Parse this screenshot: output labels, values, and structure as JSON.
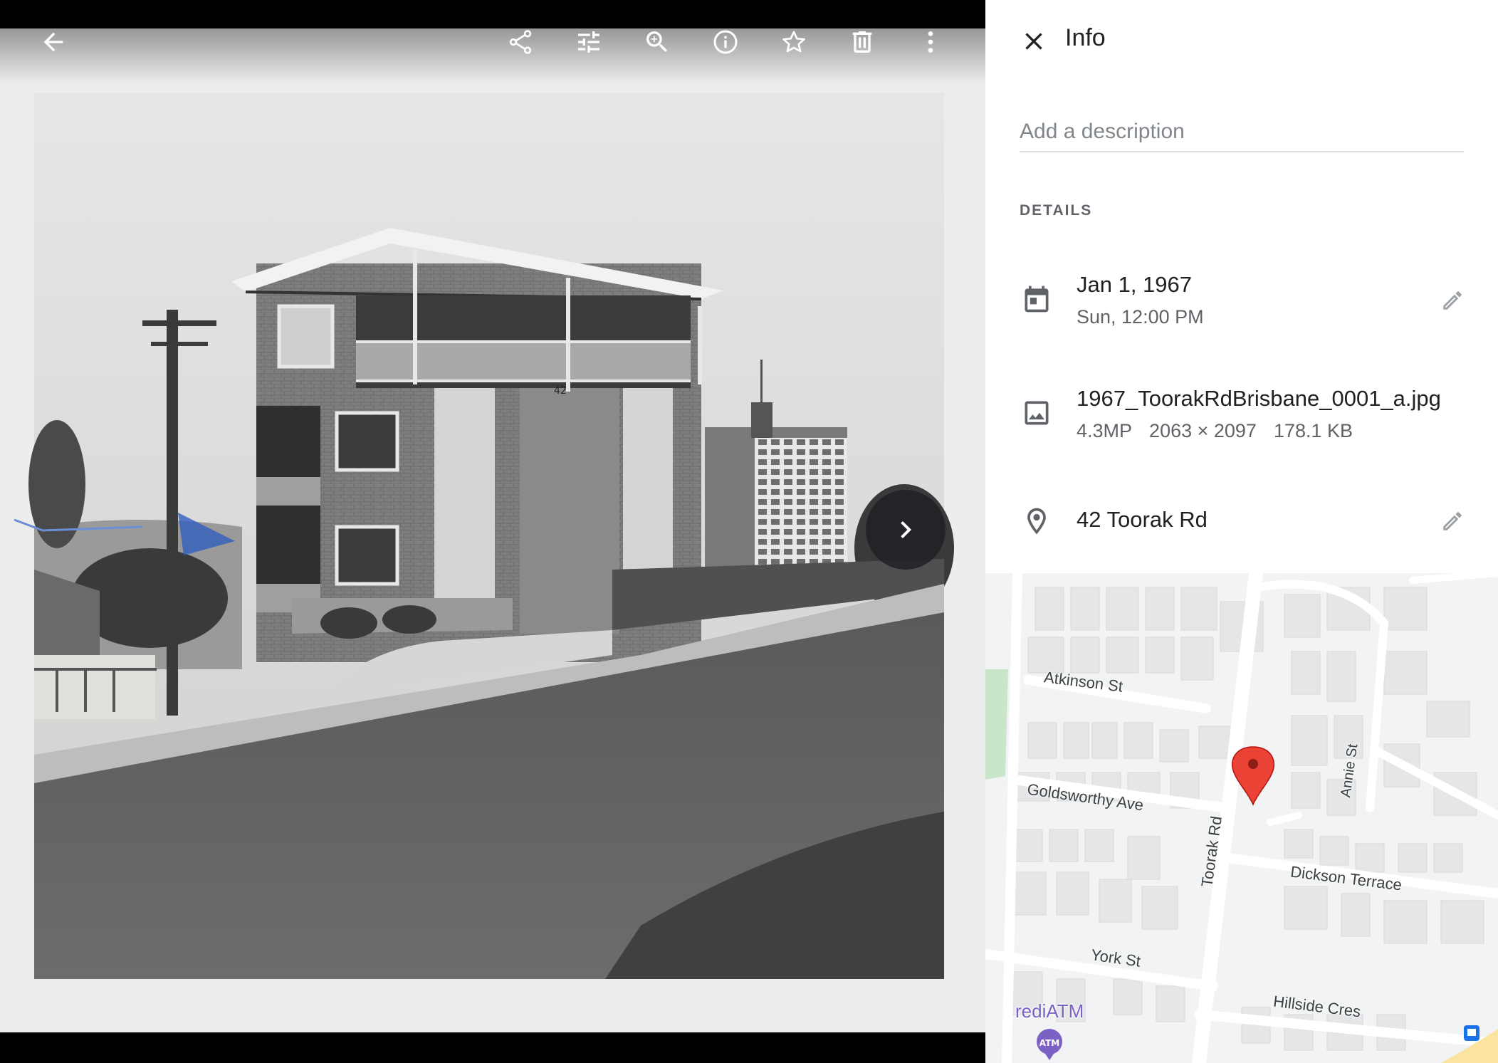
{
  "toolbar": {
    "back": "back-arrow-icon",
    "actions": [
      "share-icon",
      "edit-adjust-icon",
      "zoom-in-icon",
      "info-icon",
      "star-icon",
      "delete-icon",
      "more-vert-icon"
    ]
  },
  "photo": {
    "house_number": "42"
  },
  "info": {
    "title": "Info",
    "description_placeholder": "Add a description",
    "details_heading": "DETAILS",
    "date": {
      "primary": "Jan 1, 1967",
      "secondary": "Sun, 12:00 PM"
    },
    "file": {
      "name": "1967_ToorakRdBrisbane_0001_a.jpg",
      "megapixels": "4.3MP",
      "dimensions": "2063 × 2097",
      "size": "178.1 KB"
    },
    "location": {
      "primary": "42 Toorak Rd"
    }
  },
  "map": {
    "streets": {
      "atkinson": "Atkinson St",
      "goldsworthy": "Goldsworthy Ave",
      "toorak": "Toorak Rd",
      "annie": "Annie St",
      "dickson": "Dickson Terrace",
      "york": "York St",
      "hillside": "Hillside Cres"
    },
    "poi": "rediATM",
    "atm_badge": "ATM"
  },
  "colors": {
    "panel_bg": "#ffffff",
    "map_pin": "#ea4335",
    "text_primary": "#202124",
    "text_secondary": "#5f6368",
    "atm_purple": "#7b61c4"
  }
}
